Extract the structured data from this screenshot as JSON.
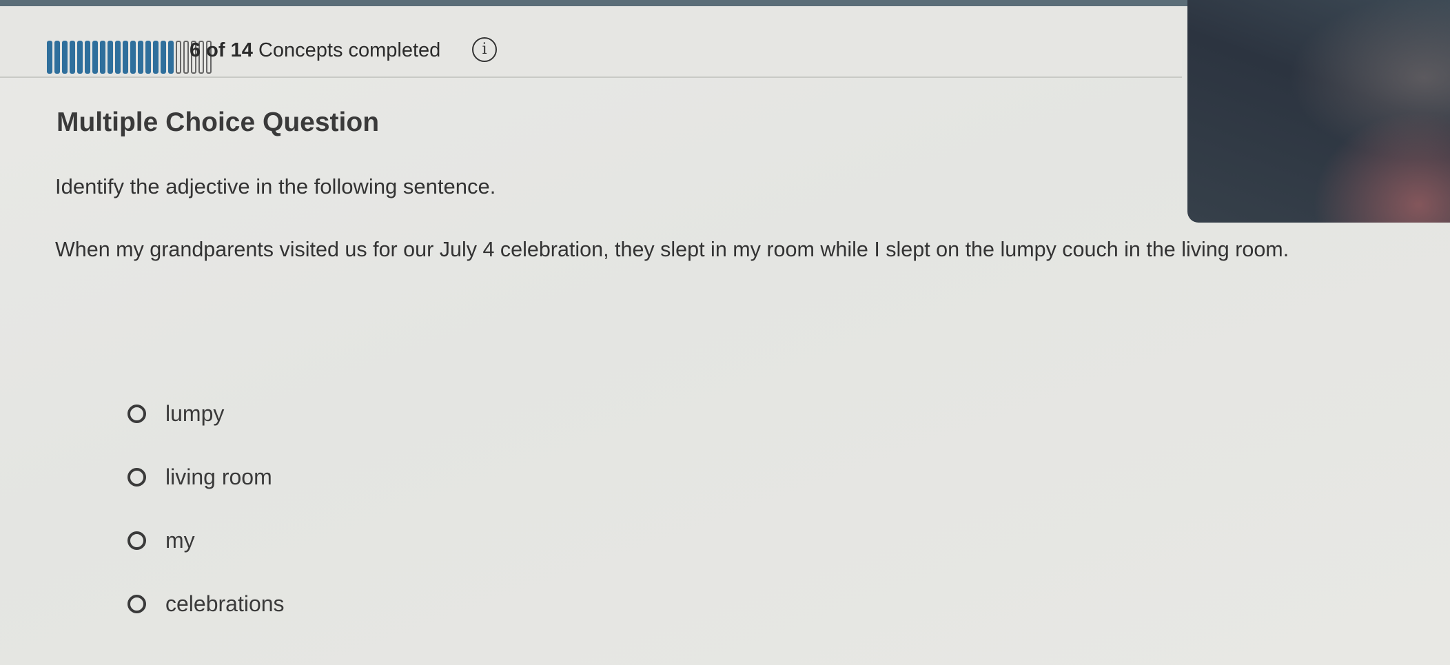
{
  "progress": {
    "segments": [
      1,
      1,
      1,
      1,
      1,
      1,
      1,
      1,
      1,
      1,
      1,
      1,
      1,
      1,
      1,
      1,
      1,
      0,
      0,
      0,
      0,
      0
    ],
    "count_label": "6 of 14",
    "suffix_label": "Concepts completed",
    "info_glyph": "i"
  },
  "question": {
    "type_label": "Multiple Choice Question",
    "prompt": "Identify the adjective in the following sentence.",
    "sentence": "When my grandparents visited us for our July 4 celebration, they slept in my room while I slept on the lumpy couch in the living room."
  },
  "options": [
    {
      "label": "lumpy",
      "selected": false
    },
    {
      "label": "living room",
      "selected": false
    },
    {
      "label": "my",
      "selected": false
    },
    {
      "label": "celebrations",
      "selected": false
    }
  ],
  "colors": {
    "progress_fill": "#2f6f9c",
    "background": "#e6e6e3",
    "text": "#333333"
  }
}
